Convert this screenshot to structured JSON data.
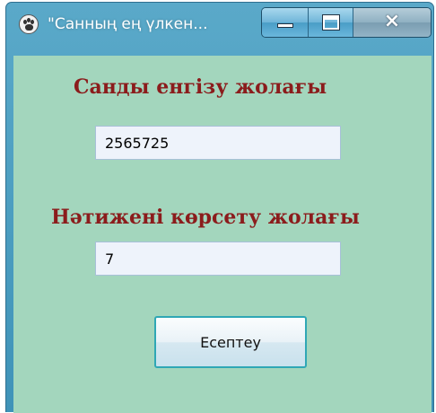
{
  "window": {
    "title": "\"Санның ең үлкен...",
    "controls": {
      "minimize": "minimize",
      "maximize": "maximize",
      "close": "x"
    }
  },
  "form": {
    "input_label": "Санды енгізу жолағы",
    "input_value": "2565725",
    "output_label": "Нәтижені көрсету жолағы",
    "output_value": "7",
    "calculate_button": "Есептеу"
  },
  "colors": {
    "client_background": "#a3d6bd",
    "label_text": "#8b1c1c",
    "title_bar": "#4a9dc6",
    "button_border": "#2fa7b5"
  },
  "icons": {
    "app_icon": "paw-icon"
  }
}
